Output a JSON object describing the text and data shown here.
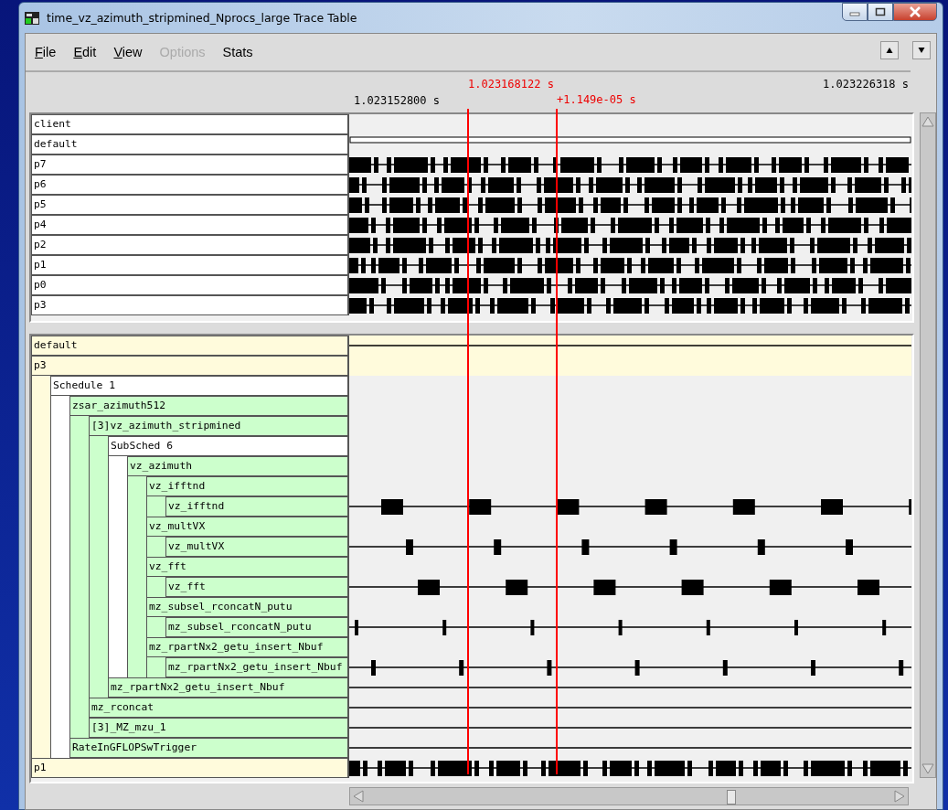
{
  "window": {
    "title": "time_vz_azimuth_stripmined_Nprocs_large Trace Table"
  },
  "menu": [
    {
      "label": "File",
      "underlined": true,
      "disabled": false
    },
    {
      "label": "Edit",
      "underlined": true,
      "disabled": false
    },
    {
      "label": "View",
      "underlined": true,
      "disabled": false
    },
    {
      "label": "Options",
      "underlined": false,
      "disabled": true
    },
    {
      "label": "Stats",
      "underlined": false,
      "disabled": false
    }
  ],
  "ruler": {
    "start": "1.023152800 s",
    "end": "1.023226318 s"
  },
  "cursors": [
    {
      "label": "1.023168122 s"
    },
    {
      "label": "+1.149e-05 s"
    }
  ],
  "top_rows": [
    {
      "label": "client",
      "kind": "none"
    },
    {
      "label": "default",
      "kind": "outline"
    },
    {
      "label": "p7",
      "kind": "dense"
    },
    {
      "label": "p6",
      "kind": "dense"
    },
    {
      "label": "p5",
      "kind": "dense"
    },
    {
      "label": "p4",
      "kind": "dense"
    },
    {
      "label": "p2",
      "kind": "dense"
    },
    {
      "label": "p1",
      "kind": "dense"
    },
    {
      "label": "p0",
      "kind": "dense"
    },
    {
      "label": "p3",
      "kind": "dense"
    }
  ],
  "tree": [
    {
      "label": "default",
      "color": "#fffbdc",
      "kind": "line"
    },
    {
      "label": "p3",
      "color": "#fffbdc",
      "kind": "none",
      "children": [
        {
          "label": "Schedule 1",
          "color": "#ffffff",
          "children": [
            {
              "label": "zsar_azimuth512",
              "color": "#ccffcc",
              "children": [
                {
                  "label": "[3]vz_azimuth_stripmined",
                  "color": "#ccffcc",
                  "children": [
                    {
                      "label": "SubSched 6",
                      "color": "#ffffff",
                      "children": [
                        {
                          "label": "vz_azimuth",
                          "color": "#ccffcc",
                          "children": [
                            {
                              "label": "vz_ifftnd",
                              "color": "#ccffcc",
                              "children": [
                                {
                                  "label": "vz_ifftnd",
                                  "color": "#ccffcc",
                                  "kind": "bars"
                                }
                              ]
                            },
                            {
                              "label": "vz_multVX",
                              "color": "#ccffcc",
                              "children": [
                                {
                                  "label": "vz_multVX",
                                  "color": "#ccffcc",
                                  "kind": "bars"
                                }
                              ]
                            },
                            {
                              "label": "vz_fft",
                              "color": "#ccffcc",
                              "children": [
                                {
                                  "label": "vz_fft",
                                  "color": "#ccffcc",
                                  "kind": "bars"
                                }
                              ]
                            },
                            {
                              "label": "mz_subsel_rconcatN_putu",
                              "color": "#ccffcc",
                              "children": [
                                {
                                  "label": "mz_subsel_rconcatN_putu",
                                  "color": "#ccffcc",
                                  "kind": "bars"
                                }
                              ]
                            },
                            {
                              "label": "mz_rpartNx2_getu_insert_Nbuf",
                              "color": "#ccffcc",
                              "children": [
                                {
                                  "label": "mz_rpartNx2_getu_insert_Nbuf",
                                  "color": "#ccffcc",
                                  "kind": "bars"
                                }
                              ]
                            }
                          ]
                        }
                      ]
                    },
                    {
                      "label": "mz_rpartNx2_getu_insert_Nbuf",
                      "color": "#ccffcc",
                      "kind": "line"
                    }
                  ]
                },
                {
                  "label": "mz_rconcat",
                  "color": "#ccffcc",
                  "kind": "line"
                },
                {
                  "label": "[3]_MZ_mzu_1",
                  "color": "#ccffcc",
                  "kind": "line"
                }
              ]
            },
            {
              "label": "RateInGFLOPSwTrigger",
              "color": "#ccffcc",
              "kind": "line"
            }
          ]
        }
      ]
    },
    {
      "label": "p1",
      "color": "#fffbdc",
      "kind": "dense"
    }
  ]
}
